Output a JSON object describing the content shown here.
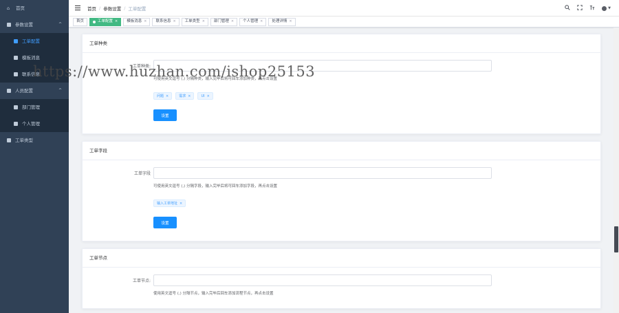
{
  "sidebar": {
    "home": "首页",
    "groups": [
      {
        "label": "参数设置",
        "arrow": "^",
        "items": [
          "工单配置",
          "模板消息",
          "联系信息"
        ]
      },
      {
        "label": "人员配置",
        "arrow": "^",
        "items": [
          "部门管理",
          "个人管理"
        ]
      }
    ],
    "bottom": "工单类型"
  },
  "navbar": {
    "breadcrumb": [
      "首页",
      "参数设置",
      "工单配置"
    ],
    "icons": [
      "search-icon",
      "fullscreen-icon",
      "font-size-icon",
      "user-icon"
    ]
  },
  "tags": [
    {
      "label": "首页",
      "active": false,
      "closable": false
    },
    {
      "label": "工单配置",
      "active": true,
      "closable": true
    },
    {
      "label": "模板消息",
      "active": false,
      "closable": true
    },
    {
      "label": "联系信息",
      "active": false,
      "closable": true
    },
    {
      "label": "工单类型",
      "active": false,
      "closable": true
    },
    {
      "label": "部门管理",
      "active": false,
      "closable": true
    },
    {
      "label": "个人管理",
      "active": false,
      "closable": true
    },
    {
      "label": "处理详情",
      "active": false,
      "closable": true
    }
  ],
  "cards": [
    {
      "title": "工单种类",
      "label": "工单种类:",
      "value": "",
      "hint": "可使用英文逗号 (,) 分隔种类，输入完毕后将可回车添加种类，再点击设置",
      "chips": [
        "问题",
        "需求",
        "UI"
      ],
      "button": "设置"
    },
    {
      "title": "工单字段",
      "label": "工单字段",
      "value": "",
      "hint": "可使用英文逗号 (,) 分隔字段，输入完毕后将可回车添加字段，再点击设置",
      "chips": [
        "输入工单地址"
      ],
      "button": "设置"
    },
    {
      "title": "工单节点",
      "label": "工单节点:",
      "value": "",
      "hint": "使用英文逗号 (,) 分隔节点，输入完毕后回车添加流程节点，再点击设置",
      "chips": [],
      "button": "设置"
    }
  ],
  "watermark": "https://www.huzhan.com/ishop25153"
}
